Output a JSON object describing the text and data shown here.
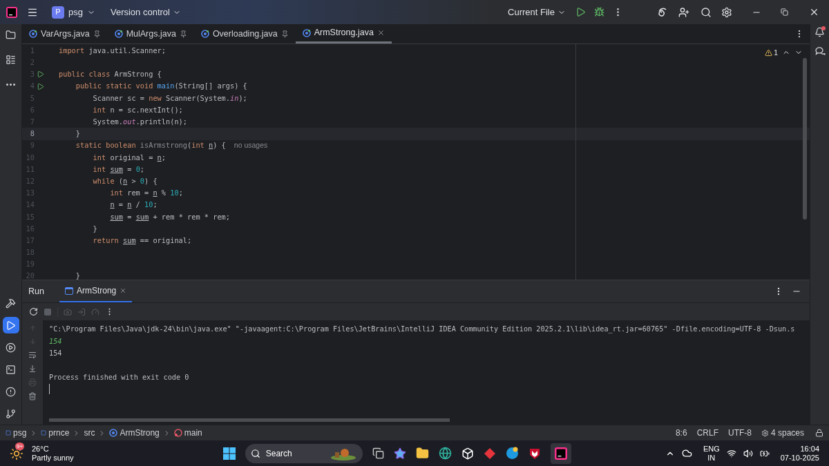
{
  "title_bar": {
    "project_badge": "P",
    "project": "psg",
    "vcs": "Version control",
    "run_config": "Current File"
  },
  "left_tools_top": [
    {
      "kind": "folder",
      "selected": false
    },
    {
      "kind": "structure",
      "selected": false
    },
    {
      "kind": "more",
      "selected": false
    }
  ],
  "left_tools_bottom": [
    {
      "kind": "build",
      "selected": false
    },
    {
      "kind": "run",
      "selected": true
    },
    {
      "kind": "services",
      "selected": false
    },
    {
      "kind": "terminal",
      "selected": false
    },
    {
      "kind": "problems",
      "selected": false
    },
    {
      "kind": "git",
      "selected": false
    }
  ],
  "editor_tabs": [
    {
      "label": "VarArgs.java",
      "pinned": true,
      "selected": false
    },
    {
      "label": "MulArgs.java",
      "pinned": true,
      "selected": false
    },
    {
      "label": "Overloading.java",
      "pinned": true,
      "selected": false
    },
    {
      "label": "ArmStrong.java",
      "pinned": false,
      "selected": true
    }
  ],
  "inspections": {
    "warnings": "1"
  },
  "code_lines": [
    {
      "number": "1",
      "current": false,
      "run_gutter": false,
      "tokens": [
        {
          "kind": "kw",
          "t": "import "
        },
        {
          "kind": "p",
          "t": "java.util.Scanner;"
        }
      ]
    },
    {
      "number": "2",
      "current": false,
      "run_gutter": false
    },
    {
      "number": "3",
      "current": false,
      "run_gutter": true,
      "tokens": [
        {
          "kind": "kw",
          "t": "public class "
        },
        {
          "kind": "p",
          "t": "ArmStrong {"
        }
      ]
    },
    {
      "number": "4",
      "current": false,
      "run_gutter": true,
      "tokens": [
        {
          "kind": "kw",
          "t": "    public static void "
        },
        {
          "kind": "fn",
          "t": "main"
        },
        {
          "kind": "p",
          "t": "(String[] args) {"
        }
      ]
    },
    {
      "number": "5",
      "current": false,
      "run_gutter": false,
      "tokens": [
        {
          "kind": "p",
          "t": "        Scanner sc = "
        },
        {
          "kind": "kw",
          "t": "new "
        },
        {
          "kind": "p",
          "t": "Scanner(System."
        },
        {
          "kind": "st",
          "t": "in"
        },
        {
          "kind": "p",
          "t": ");"
        }
      ]
    },
    {
      "number": "6",
      "current": false,
      "run_gutter": false,
      "tokens": [
        {
          "kind": "kw",
          "t": "        int "
        },
        {
          "kind": "p",
          "t": "n = sc.nextInt();"
        }
      ]
    },
    {
      "number": "7",
      "current": false,
      "run_gutter": false,
      "tokens": [
        {
          "kind": "p",
          "t": "        System."
        },
        {
          "kind": "st",
          "t": "out"
        },
        {
          "kind": "p",
          "t": ".println(n);"
        }
      ]
    },
    {
      "number": "8",
      "current": true,
      "run_gutter": false,
      "tokens": [
        {
          "kind": "p",
          "t": "    }"
        }
      ]
    },
    {
      "number": "9",
      "current": false,
      "run_gutter": false,
      "tokens": [
        {
          "kind": "kw",
          "t": "    static boolean "
        },
        {
          "kind": "un",
          "t": "isArmstrong"
        },
        {
          "kind": "p",
          "t": "("
        },
        {
          "kind": "kw",
          "t": "int "
        },
        {
          "kind": "var",
          "t": "n"
        },
        {
          "kind": "p",
          "t": ") {"
        }
      ],
      "hint": "no usages"
    },
    {
      "number": "10",
      "current": false,
      "run_gutter": false,
      "tokens": [
        {
          "kind": "kw",
          "t": "        int "
        },
        {
          "kind": "p",
          "t": "original = "
        },
        {
          "kind": "var",
          "t": "n"
        },
        {
          "kind": "p",
          "t": ";"
        }
      ]
    },
    {
      "number": "11",
      "current": false,
      "run_gutter": false,
      "tokens": [
        {
          "kind": "kw",
          "t": "        int "
        },
        {
          "kind": "var",
          "t": "sum"
        },
        {
          "kind": "p",
          "t": " = "
        },
        {
          "kind": "num",
          "t": "0"
        },
        {
          "kind": "p",
          "t": ";"
        }
      ]
    },
    {
      "number": "12",
      "current": false,
      "run_gutter": false,
      "tokens": [
        {
          "kind": "kw",
          "t": "        while "
        },
        {
          "kind": "p",
          "t": "("
        },
        {
          "kind": "var",
          "t": "n"
        },
        {
          "kind": "p",
          "t": " > "
        },
        {
          "kind": "num",
          "t": "0"
        },
        {
          "kind": "p",
          "t": ") {"
        }
      ]
    },
    {
      "number": "13",
      "current": false,
      "run_gutter": false,
      "tokens": [
        {
          "kind": "kw",
          "t": "            int "
        },
        {
          "kind": "p",
          "t": "rem = "
        },
        {
          "kind": "var",
          "t": "n"
        },
        {
          "kind": "p",
          "t": " % "
        },
        {
          "kind": "num",
          "t": "10"
        },
        {
          "kind": "p",
          "t": ";"
        }
      ]
    },
    {
      "number": "14",
      "current": false,
      "run_gutter": false,
      "tokens": [
        {
          "kind": "var",
          "t": "            n"
        },
        {
          "kind": "p",
          "t": " = "
        },
        {
          "kind": "var",
          "t": "n"
        },
        {
          "kind": "p",
          "t": " / "
        },
        {
          "kind": "num",
          "t": "10"
        },
        {
          "kind": "p",
          "t": ";"
        }
      ]
    },
    {
      "number": "15",
      "current": false,
      "run_gutter": false,
      "tokens": [
        {
          "kind": "var",
          "t": "            sum"
        },
        {
          "kind": "p",
          "t": " = "
        },
        {
          "kind": "var",
          "t": "sum"
        },
        {
          "kind": "p",
          "t": " + rem * rem * rem;"
        }
      ]
    },
    {
      "number": "16",
      "current": false,
      "run_gutter": false,
      "tokens": [
        {
          "kind": "p",
          "t": "        }"
        }
      ]
    },
    {
      "number": "17",
      "current": false,
      "run_gutter": false,
      "tokens": [
        {
          "kind": "kw",
          "t": "        return "
        },
        {
          "kind": "var",
          "t": "sum"
        },
        {
          "kind": "p",
          "t": " == original;"
        }
      ]
    },
    {
      "number": "18",
      "current": false,
      "run_gutter": false
    },
    {
      "number": "19",
      "current": false,
      "run_gutter": false
    },
    {
      "number": "20",
      "current": false,
      "run_gutter": false,
      "tokens": [
        {
          "kind": "p",
          "t": "    }"
        }
      ]
    }
  ],
  "run_panel": {
    "title": "Run",
    "tabs": [
      {
        "label": "ArmStrong",
        "selected": true
      }
    ],
    "console": [
      {
        "kind": "command",
        "text": "\"C:\\Program Files\\Java\\jdk-24\\bin\\java.exe\" \"-javaagent:C:\\Program Files\\JetBrains\\IntelliJ IDEA Community Edition 2025.2.1\\lib\\idea_rt.jar=60765\" -Dfile.encoding=UTF-8 -Dsun.s"
      },
      {
        "kind": "input",
        "text": "154"
      },
      {
        "kind": "output",
        "text": "154"
      },
      {
        "kind": "blank"
      },
      {
        "kind": "output",
        "text": "Process finished with exit code 0"
      }
    ]
  },
  "status_bar": {
    "breadcrumbs": [
      {
        "kind": "module",
        "label": "psg"
      },
      {
        "kind": "module",
        "label": "prnce"
      },
      {
        "kind": "folder",
        "label": "src"
      },
      {
        "kind": "class",
        "label": "ArmStrong"
      },
      {
        "kind": "method",
        "label": "main"
      }
    ],
    "position": "8:6",
    "line_ending": "CRLF",
    "encoding": "UTF-8",
    "indent": "4 spaces"
  },
  "taskbar": {
    "weather_badge": "9+",
    "temperature": "26°C",
    "weather": "Partly sunny",
    "search": "Search",
    "language": "ENG",
    "region": "IN",
    "time": "16:04",
    "date": "07-10-2025"
  }
}
